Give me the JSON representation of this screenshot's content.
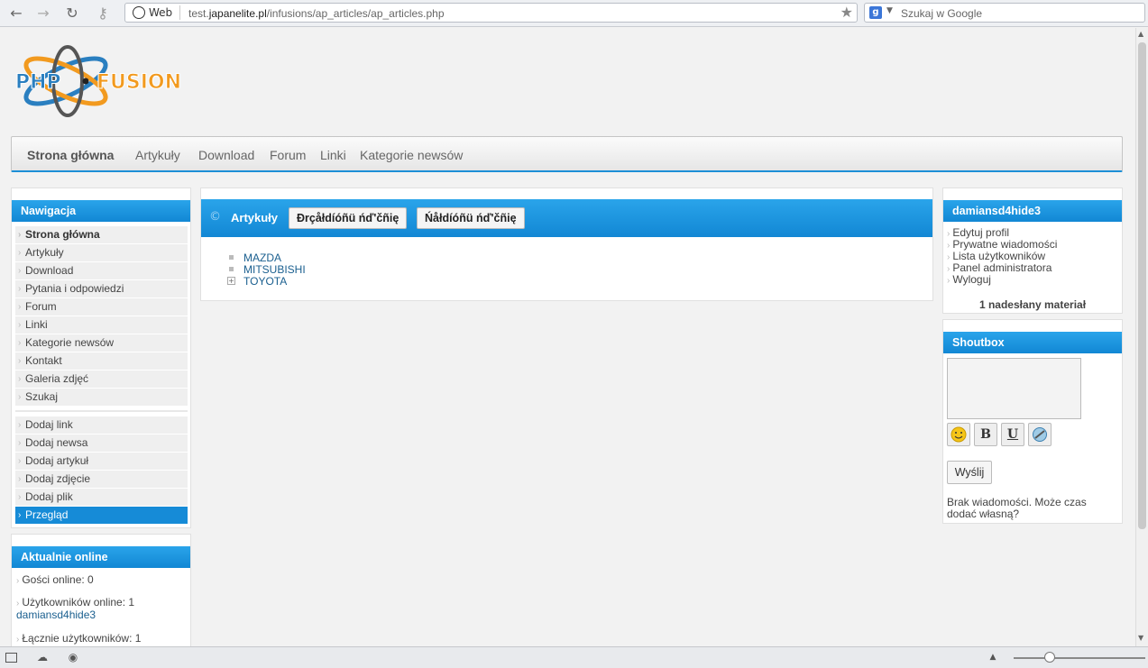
{
  "browser": {
    "web_label": "Web",
    "url_prefix": "test.",
    "url_domain": "japanelite.pl",
    "url_path": "/infusions/ap_articles/ap_articles.php",
    "search_placeholder": "Szukaj w Google",
    "search_engine_letter": "g"
  },
  "site": {
    "logo_left": "PHP",
    "logo_right": "FUSION"
  },
  "top_menu": [
    {
      "label": "Strona główna",
      "active": true
    },
    {
      "label": "Artykuły"
    },
    {
      "label": "Download"
    },
    {
      "label": "Forum"
    },
    {
      "label": "Linki"
    },
    {
      "label": "Kategorie newsów"
    }
  ],
  "nav_panel": {
    "title": "Nawigacja",
    "items": [
      "Strona główna",
      "Artykuły",
      "Download",
      "Pytania i odpowiedzi",
      "Forum",
      "Linki",
      "Kategorie newsów",
      "Kontakt",
      "Galeria zdjęć",
      "Szukaj"
    ],
    "items2": [
      "Dodaj link",
      "Dodaj newsa",
      "Dodaj artykuł",
      "Dodaj zdjęcie",
      "Dodaj plik",
      "Przegląd"
    ]
  },
  "online_panel": {
    "title": "Aktualnie online",
    "guests": "Gości online: 0",
    "users": "Użytkowników online: 1",
    "user_name": "damiansd4hide3",
    "total": "Łącznie użytkowników: 1"
  },
  "center": {
    "copyright_symbol": "©",
    "title": "Artykuły",
    "btn1": "Ðrçåłdíóñü ńď'čñię",
    "btn2": "Ńåłdíóñü ńď'čñię",
    "categories": [
      "MAZDA",
      "MITSUBISHI",
      "TOYOTA"
    ]
  },
  "user_panel": {
    "title": "damiansd4hide3",
    "links": [
      "Edytuj profil",
      "Prywatne wiadomości",
      "Lista użytkowników",
      "Panel administratora",
      "Wyloguj"
    ],
    "submissions": "1 nadesłany materiał"
  },
  "shoutbox": {
    "title": "Shoutbox",
    "bold": "B",
    "underline": "U",
    "send": "Wyślij",
    "empty": "Brak wiadomości. Może czas dodać własną?"
  }
}
